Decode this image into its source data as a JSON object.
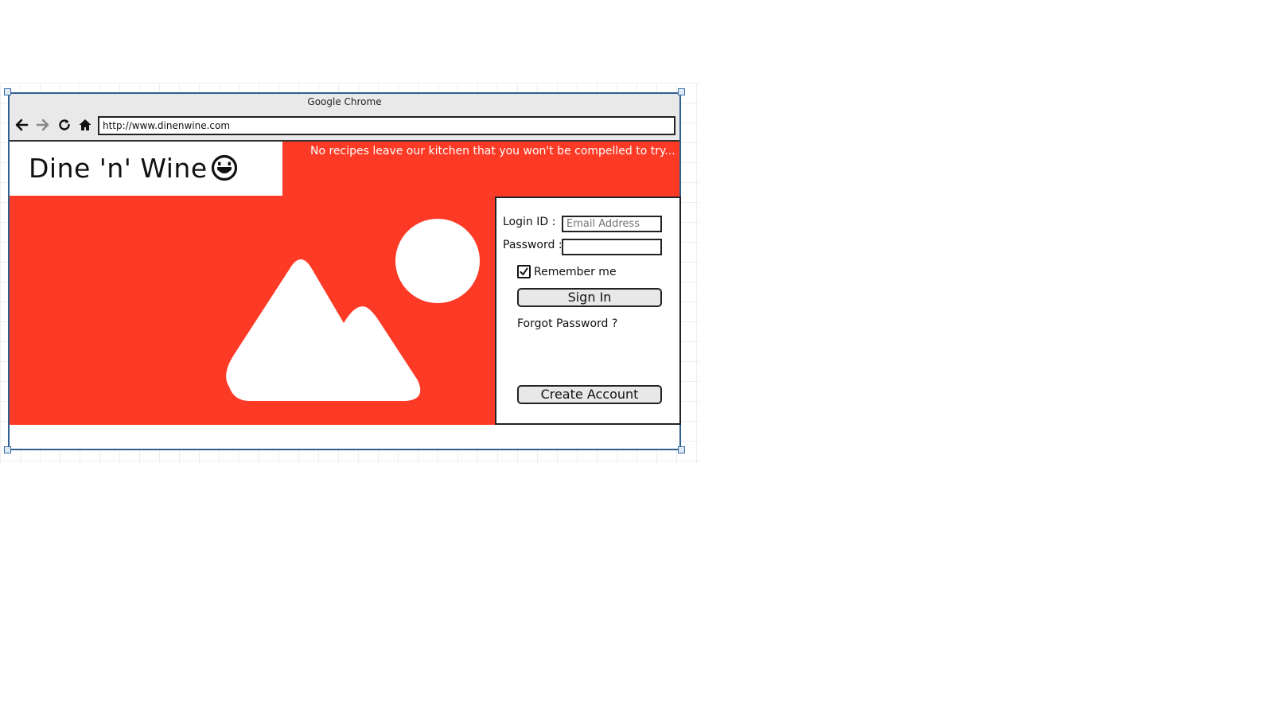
{
  "browser": {
    "window_title": "Google Chrome",
    "url": "http://www.dinenwine.com",
    "nav_icons": [
      "back-arrow-icon",
      "forward-arrow-icon",
      "reload-icon",
      "home-icon"
    ]
  },
  "site": {
    "logo_text": "Dine 'n' Wine",
    "logo_icon": "smiley-face-icon",
    "tagline": "No recipes leave our kitchen that you won't be compelled to try...",
    "hero_image_icon": "image-placeholder-icon",
    "colors": {
      "background": "#fd3a25",
      "panel": "#ffffff",
      "button": "#e8e8e8"
    }
  },
  "login": {
    "login_id_label": "Login ID :",
    "login_id_placeholder": "Email Address",
    "password_label": "Password :",
    "remember_label": "Remember me",
    "remember_checked": true,
    "sign_in_label": "Sign In",
    "forgot_label": "Forgot Password ?",
    "create_account_label": "Create Account"
  }
}
